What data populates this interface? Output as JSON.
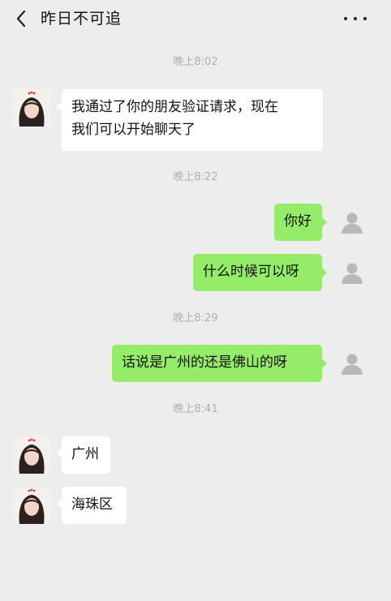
{
  "header": {
    "title": "昨日不可追",
    "back_icon": "chevron-left-icon",
    "more_icon": "more-horizontal-icon"
  },
  "messages": {
    "ts1": "晚上8:02",
    "m1": "我通过了你的朋友验证请求，现在\n我们可以开始聊天了",
    "ts2": "晚上8:22",
    "m2": "你好",
    "m3": "什么时候可以呀",
    "ts3": "晚上8:29",
    "m4": "话说是广州的还是佛山的呀",
    "ts4": "晚上8:41",
    "m5": "广州",
    "m6": "海珠区"
  },
  "colors": {
    "background": "#ededed",
    "outgoing_bubble": "#95ec69",
    "incoming_bubble": "#ffffff",
    "timestamp": "#b0b0b0"
  }
}
